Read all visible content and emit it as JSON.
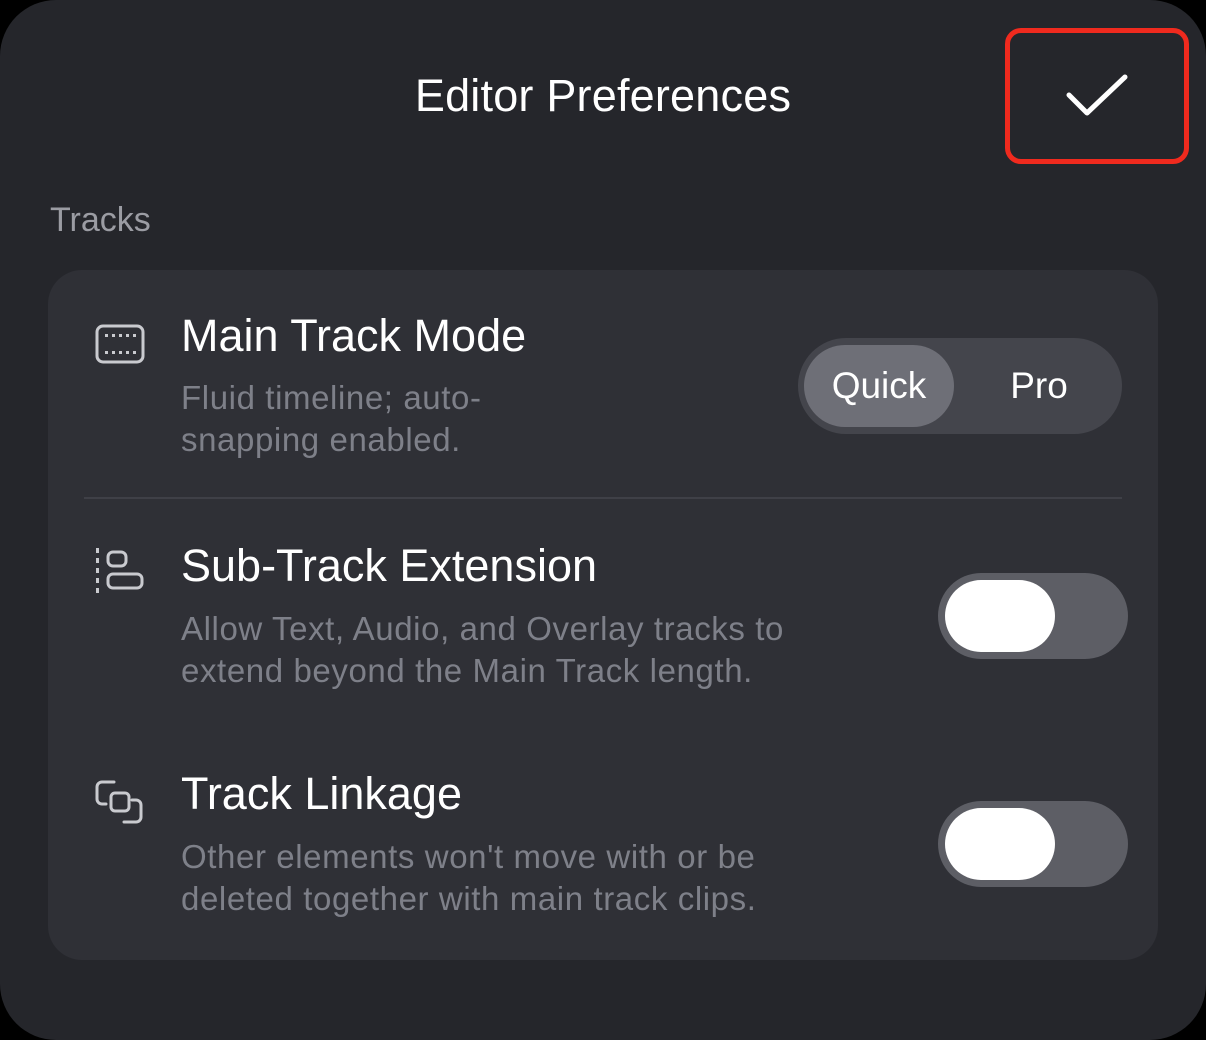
{
  "header": {
    "title": "Editor Preferences",
    "confirm_icon": "checkmark-icon",
    "highlight_color": "#f02a1e"
  },
  "section": {
    "label": "Tracks"
  },
  "rows": [
    {
      "icon": "track-layout-icon",
      "title": "Main Track Mode",
      "description_lines": [
        "Fluid timeline; auto-",
        "snapping enabled."
      ],
      "control": {
        "type": "segmented",
        "options": [
          "Quick",
          "Pro"
        ],
        "selected": "Quick"
      }
    },
    {
      "icon": "sub-track-extension-icon",
      "title": "Sub-Track Extension",
      "description_lines": [
        "Allow Text, Audio, and Overlay tracks to",
        "extend beyond the Main Track length."
      ],
      "control": {
        "type": "toggle",
        "on": false
      }
    },
    {
      "icon": "linked-squares-icon",
      "title": "Track Linkage",
      "description_lines": [
        "Other elements won't move with or be",
        "deleted together with main track clips."
      ],
      "control": {
        "type": "toggle",
        "on": false
      }
    }
  ],
  "colors": {
    "background": "#25262b",
    "card": "#2f3036",
    "toggle_off": "#5d5e65",
    "secondary_text": "#7e8089"
  }
}
